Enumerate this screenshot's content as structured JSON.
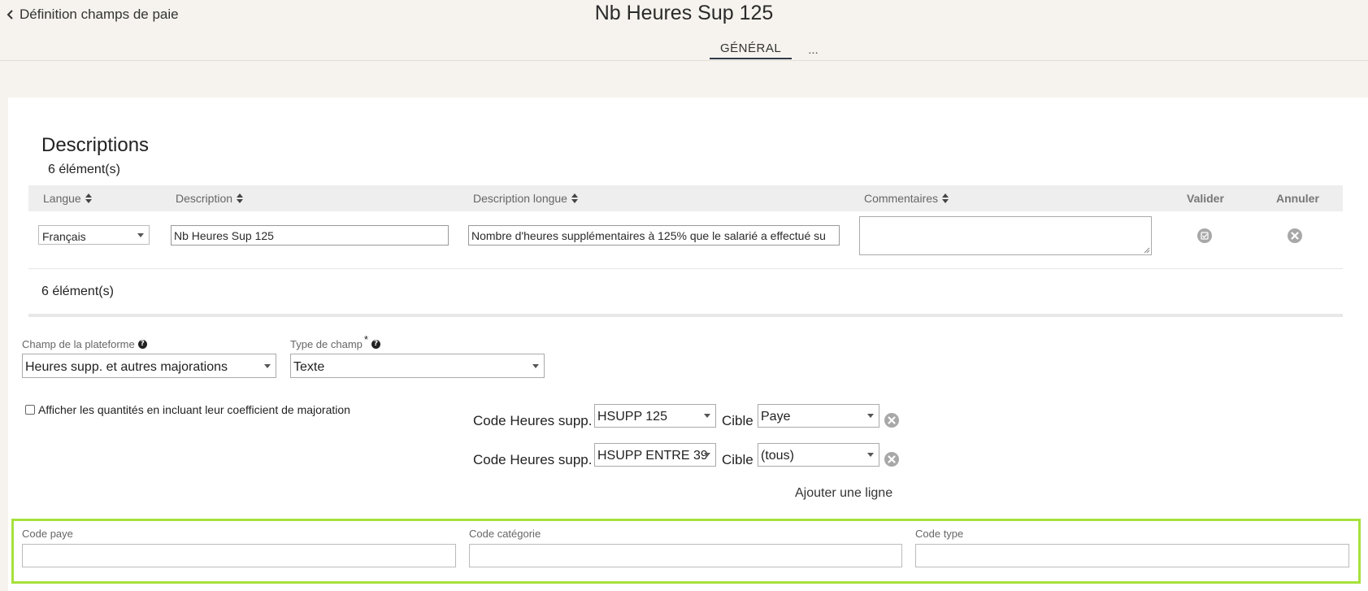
{
  "header": {
    "back_label": "Définition champs de paie",
    "title": "Nb Heures Sup 125",
    "tabs": [
      {
        "label": "GÉNÉRAL",
        "active": true
      },
      {
        "label": "...",
        "active": false
      }
    ]
  },
  "descriptions": {
    "heading": "Descriptions",
    "count_top": "6 élément(s)",
    "count_bottom": "6 élément(s)",
    "columns": {
      "langue": "Langue",
      "description": "Description",
      "description_longue": "Description longue",
      "commentaires": "Commentaires",
      "valider": "Valider",
      "annuler": "Annuler"
    },
    "row": {
      "langue": "Français",
      "description": "Nb Heures Sup 125",
      "description_longue": "Nombre d'heures supplémentaires à 125% que le salarié a effectué su",
      "commentaires": ""
    }
  },
  "form": {
    "champ_plateforme": {
      "label": "Champ de la plateforme",
      "value": "Heures supp. et autres majorations"
    },
    "type_champ": {
      "label": "Type de champ",
      "required_mark": "*",
      "value": "Texte"
    },
    "checkbox": {
      "label": "Afficher les quantités en incluant leur coefficient de majoration",
      "checked": false
    },
    "heures_supp_rows": [
      {
        "label": "Code Heures supp.",
        "code": "HSUPP 125",
        "cible_label": "Cible",
        "cible": "Paye"
      },
      {
        "label": "Code Heures supp.",
        "code": "HSUPP ENTRE 39",
        "cible_label": "Cible",
        "cible": "(tous)"
      }
    ],
    "add_line_label": "Ajouter une ligne",
    "codes": {
      "code_paye": {
        "label": "Code paye",
        "value": ""
      },
      "code_categorie": {
        "label": "Code catégorie",
        "value": ""
      },
      "code_type": {
        "label": "Code type",
        "value": ""
      }
    }
  },
  "colors": {
    "background": "#f6f3ee",
    "highlight_border": "#a6e13c",
    "tab_underline": "#2f3b46",
    "icon_gray": "#a8a8a8"
  }
}
